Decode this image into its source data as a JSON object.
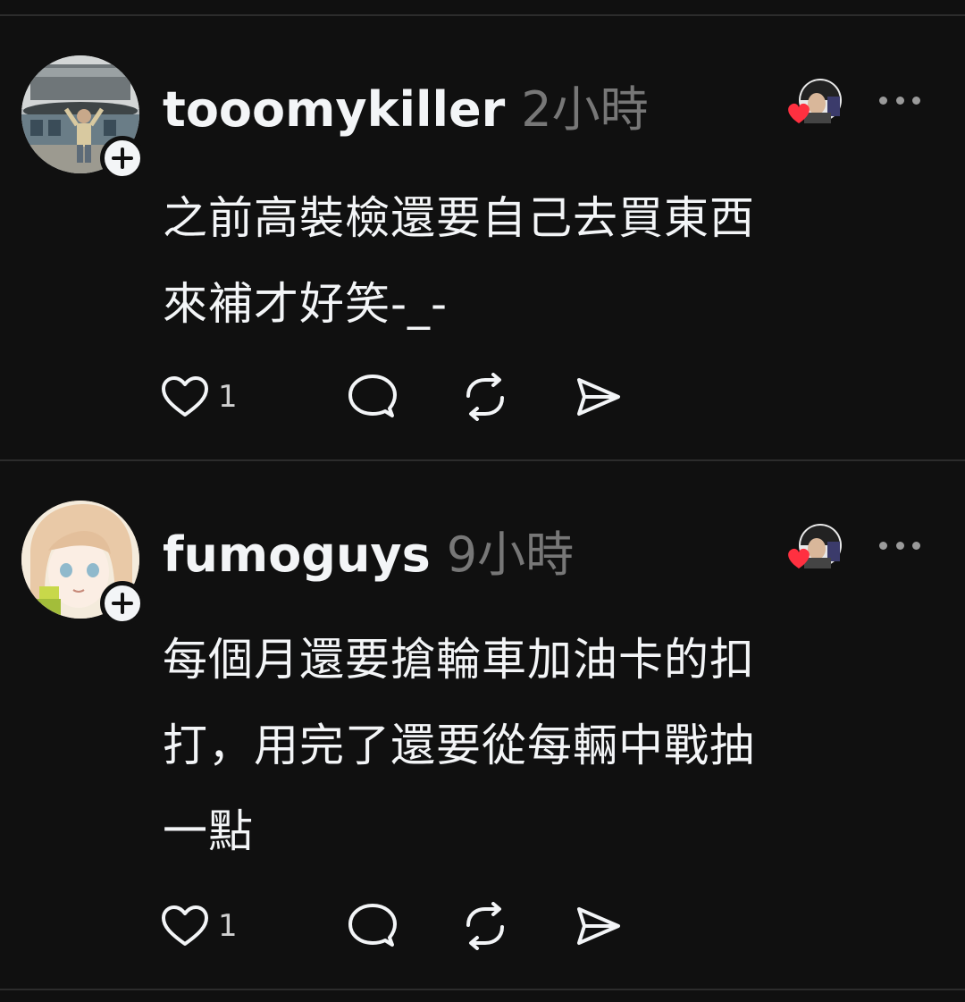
{
  "posts": [
    {
      "username": "tooomykiller",
      "time": "2小時",
      "text_lines": [
        "之前高裝檢還要自己去買東西",
        "來補才好笑-_-"
      ],
      "likes": "1"
    },
    {
      "username": "fumoguys",
      "time": "9小時",
      "text_lines": [
        "每個月還要搶輪車加油卡的扣",
        "打，用完了還要從每輛中戰抽",
        "一點"
      ],
      "likes": "1"
    }
  ],
  "icons": {
    "follow": "plus-icon",
    "liked_by": "heart-icon",
    "more": "ellipsis-icon",
    "like": "heart-outline-icon",
    "reply": "speech-bubble-icon",
    "repost": "repost-icon",
    "share": "send-icon"
  },
  "colors": {
    "background": "#101010",
    "text": "#f3f5f7",
    "secondary": "#777777",
    "heart": "#ff3040"
  }
}
